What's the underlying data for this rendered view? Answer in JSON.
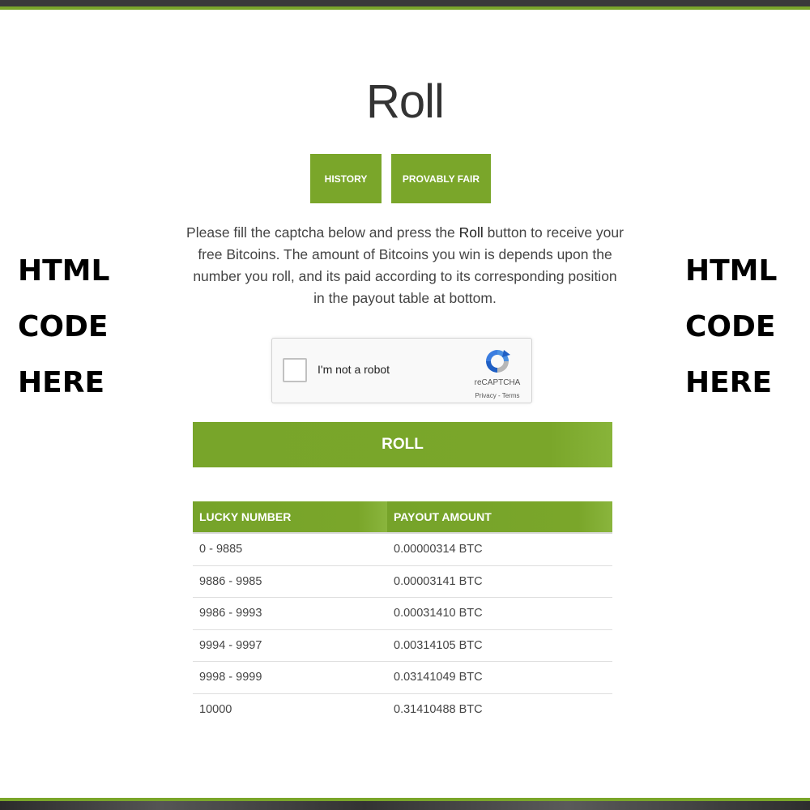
{
  "side_text_left": [
    "HTML",
    "CODE",
    "HERE"
  ],
  "side_text_right": [
    "HTML",
    "CODE",
    "HERE"
  ],
  "page_title": "Roll",
  "tabs": {
    "history": "HISTORY",
    "provably_fair": "PROVABLY FAIR"
  },
  "intro": {
    "part1": "Please fill the captcha below and press the ",
    "bold": "Roll",
    "part2": " button to receive your free Bitcoins. The amount of Bitcoins you win is depends upon the number you roll, and its paid according to its corresponding position in the payout table at bottom."
  },
  "captcha": {
    "label": "I'm not a robot",
    "brand": "reCAPTCHA",
    "links": "Privacy - Terms"
  },
  "roll_button": "ROLL",
  "payout_table": {
    "headers": [
      "LUCKY NUMBER",
      "PAYOUT AMOUNT"
    ],
    "rows": [
      [
        "0 - 9885",
        "0.00000314 BTC"
      ],
      [
        "9886 - 9985",
        "0.00003141 BTC"
      ],
      [
        "9986 - 9993",
        "0.00031410 BTC"
      ],
      [
        "9994 - 9997",
        "0.00314105 BTC"
      ],
      [
        "9998 - 9999",
        "0.03141049 BTC"
      ],
      [
        "10000",
        "0.31410488 BTC"
      ]
    ]
  },
  "colors": {
    "accent": "#7aa62a",
    "top_bar": "#3a3a3a",
    "text": "#333333"
  },
  "icons": {
    "recaptcha": "recaptcha-icon"
  }
}
